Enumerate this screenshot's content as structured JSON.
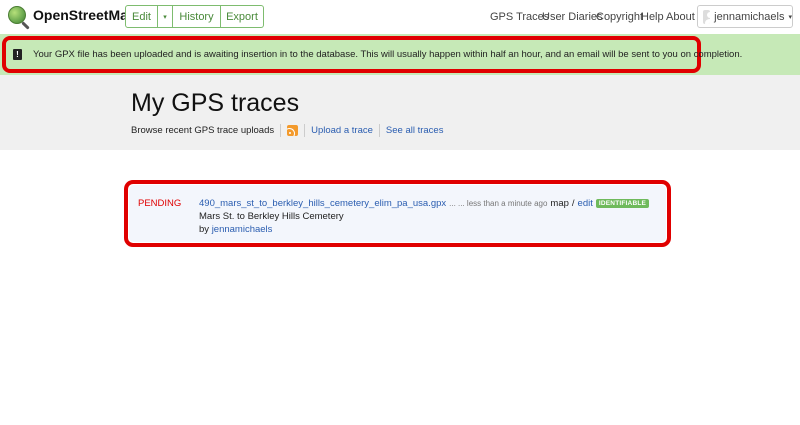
{
  "header": {
    "logo_text": "OpenStreetMap",
    "edit_label": "Edit",
    "caret": "▾",
    "history_label": "History",
    "export_label": "Export",
    "nav": {
      "gps_traces": "GPS Traces",
      "user_diaries": "User Diaries",
      "copyright": "Copyright",
      "help": "Help",
      "about": "About"
    },
    "username": "jennamichaels"
  },
  "flash": {
    "icon_glyph": "!",
    "message": "Your GPX file has been uploaded and is awaiting insertion in to the database. This will usually happen within half an hour, and an email will be sent to you on completion."
  },
  "page": {
    "title": "My GPS traces",
    "browse_text": "Browse recent GPS trace uploads",
    "upload_link": "Upload a trace",
    "see_all_link": "See all traces"
  },
  "trace": {
    "status": "PENDING",
    "filename": "490_mars_st_to_berkley_hills_cemetery_elim_pa_usa.gpx",
    "meta": "... ... less than a minute ago",
    "map_label": "map",
    "slash": "/",
    "edit_label": "edit",
    "badge": "IDENTIFIABLE",
    "description": "Mars St. to Berkley Hills Cemetery",
    "by_prefix": "by",
    "owner": "jennamichaels"
  },
  "colors": {
    "accent_green": "#7ebc6f",
    "flash_bg": "#c6e9b7",
    "highlight_red": "#e00000",
    "link_blue": "#2a5db0"
  }
}
